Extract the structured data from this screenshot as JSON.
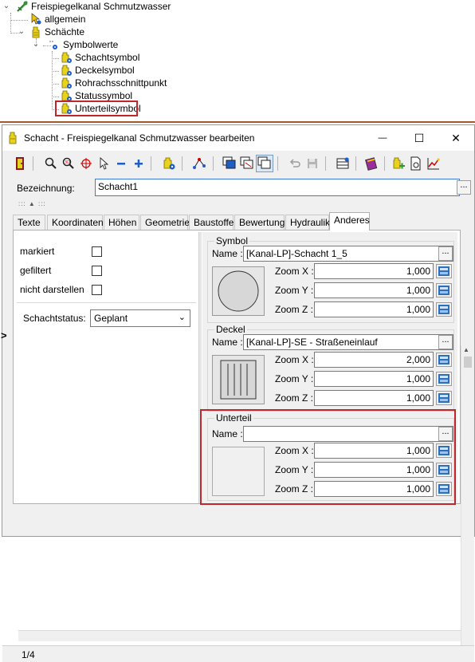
{
  "tree": {
    "root": "Freispiegelkanal Schmutzwasser",
    "items": [
      {
        "label": "allgemein"
      },
      {
        "label": "Schächte"
      },
      {
        "label": "Symbolwerte"
      },
      {
        "label": "Schachtsymbol"
      },
      {
        "label": "Deckelsymbol"
      },
      {
        "label": "Rohrachsschnittpunkt"
      },
      {
        "label": "Statussymbol"
      },
      {
        "label": "Unterteilsymbol"
      }
    ]
  },
  "window": {
    "title": "Schacht - Freispiegelkanal Schmutzwasser bearbeiten",
    "min_glyph": "—",
    "max_glyph": "☐",
    "close_glyph": "✕"
  },
  "form": {
    "bezeichnung_label": "Bezeichnung:",
    "bezeichnung_value": "Schacht1",
    "dots": "..."
  },
  "tabs": [
    "Texte",
    "Koordinaten",
    "Höhen",
    "Geometrie",
    "Baustoffe",
    "Bewertung",
    "Hydraulik",
    "Anderes"
  ],
  "active_tab": "Anderes",
  "left": {
    "markiert": "markiert",
    "gefiltert": "gefiltert",
    "nicht_darstellen": "nicht darstellen",
    "schachtstatus_label": "Schachtstatus:",
    "schachtstatus_value": "Geplant"
  },
  "symbol": {
    "title": "Symbol",
    "name_label": "Name :",
    "name_value": "[Kanal-LP]-Schacht 1_5",
    "zoom_x_label": "Zoom X :",
    "zoom_x": "1,000",
    "zoom_y_label": "Zoom Y :",
    "zoom_y": "1,000",
    "zoom_z_label": "Zoom Z :",
    "zoom_z": "1,000"
  },
  "deckel": {
    "title": "Deckel",
    "name_label": "Name :",
    "name_value": "[Kanal-LP]-SE - Straßeneinlauf",
    "zoom_x_label": "Zoom X :",
    "zoom_x": "2,000",
    "zoom_y_label": "Zoom Y :",
    "zoom_y": "1,000",
    "zoom_z_label": "Zoom Z :",
    "zoom_z": "1,000"
  },
  "unterteil": {
    "title": "Unterteil",
    "name_label": "Name :",
    "name_value": "",
    "zoom_x_label": "Zoom X :",
    "zoom_x": "1,000",
    "zoom_y_label": "Zoom Y :",
    "zoom_y": "1,000",
    "zoom_z_label": "Zoom Z :",
    "zoom_z": "1,000"
  },
  "status": {
    "record": "1/4"
  },
  "side_arrow": ">",
  "colors": {
    "highlight": "#c0262c",
    "divider": "#a05a2c",
    "shaft_yellow": "#e8d31c",
    "gear_blue": "#1e5ec8"
  }
}
